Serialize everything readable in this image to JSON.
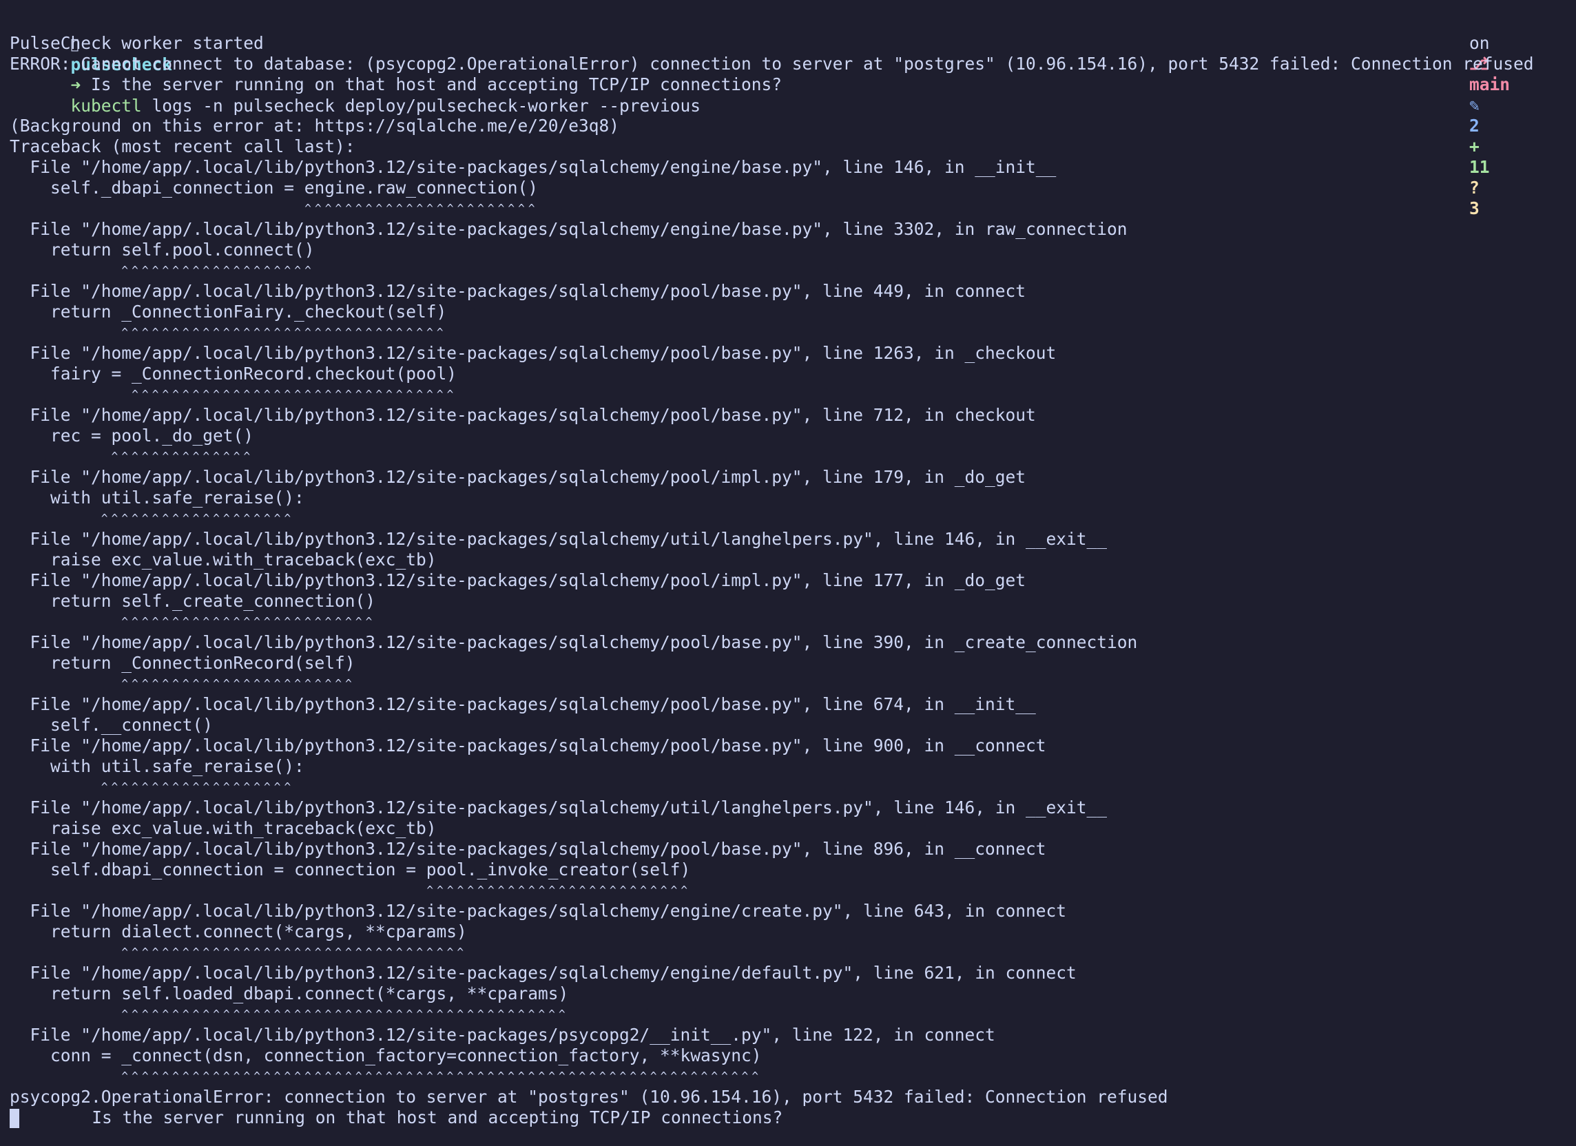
{
  "prompt": {
    "apple_icon": "",
    "directory": "pulsecheck",
    "arrow": "➜",
    "command": "kubectl",
    "args": " logs -n pulsecheck deploy/pulsecheck-worker --previous",
    "on_label": "on",
    "branch_icon": "⎇",
    "branch": "main",
    "modified_icon": "✎",
    "modified_count": "2",
    "added_icon": "+",
    "added_count": "11",
    "untracked_icon": "?",
    "untracked_count": "3"
  },
  "lines": [
    "PulseCheck worker started",
    "ERROR: Cannot connect to database: (psycopg2.OperationalError) connection to server at \"postgres\" (10.96.154.16), port 5432 failed: Connection refused",
    "        Is the server running on that host and accepting TCP/IP connections?",
    "",
    "(Background on this error at: https://sqlalche.me/e/20/e3q8)",
    "Traceback (most recent call last):",
    "  File \"/home/app/.local/lib/python3.12/site-packages/sqlalchemy/engine/base.py\", line 146, in __init__",
    "    self._dbapi_connection = engine.raw_connection()",
    "                             ^^^^^^^^^^^^^^^^^^^^^^^",
    "  File \"/home/app/.local/lib/python3.12/site-packages/sqlalchemy/engine/base.py\", line 3302, in raw_connection",
    "    return self.pool.connect()",
    "           ^^^^^^^^^^^^^^^^^^^",
    "  File \"/home/app/.local/lib/python3.12/site-packages/sqlalchemy/pool/base.py\", line 449, in connect",
    "    return _ConnectionFairy._checkout(self)",
    "           ^^^^^^^^^^^^^^^^^^^^^^^^^^^^^^^^",
    "  File \"/home/app/.local/lib/python3.12/site-packages/sqlalchemy/pool/base.py\", line 1263, in _checkout",
    "    fairy = _ConnectionRecord.checkout(pool)",
    "            ^^^^^^^^^^^^^^^^^^^^^^^^^^^^^^^^",
    "  File \"/home/app/.local/lib/python3.12/site-packages/sqlalchemy/pool/base.py\", line 712, in checkout",
    "    rec = pool._do_get()",
    "          ^^^^^^^^^^^^^^",
    "  File \"/home/app/.local/lib/python3.12/site-packages/sqlalchemy/pool/impl.py\", line 179, in _do_get",
    "    with util.safe_reraise():",
    "         ^^^^^^^^^^^^^^^^^^^",
    "  File \"/home/app/.local/lib/python3.12/site-packages/sqlalchemy/util/langhelpers.py\", line 146, in __exit__",
    "    raise exc_value.with_traceback(exc_tb)",
    "  File \"/home/app/.local/lib/python3.12/site-packages/sqlalchemy/pool/impl.py\", line 177, in _do_get",
    "    return self._create_connection()",
    "           ^^^^^^^^^^^^^^^^^^^^^^^^^",
    "  File \"/home/app/.local/lib/python3.12/site-packages/sqlalchemy/pool/base.py\", line 390, in _create_connection",
    "    return _ConnectionRecord(self)",
    "           ^^^^^^^^^^^^^^^^^^^^^^^",
    "  File \"/home/app/.local/lib/python3.12/site-packages/sqlalchemy/pool/base.py\", line 674, in __init__",
    "    self.__connect()",
    "  File \"/home/app/.local/lib/python3.12/site-packages/sqlalchemy/pool/base.py\", line 900, in __connect",
    "    with util.safe_reraise():",
    "         ^^^^^^^^^^^^^^^^^^^",
    "  File \"/home/app/.local/lib/python3.12/site-packages/sqlalchemy/util/langhelpers.py\", line 146, in __exit__",
    "    raise exc_value.with_traceback(exc_tb)",
    "  File \"/home/app/.local/lib/python3.12/site-packages/sqlalchemy/pool/base.py\", line 896, in __connect",
    "    self.dbapi_connection = connection = pool._invoke_creator(self)",
    "                                         ^^^^^^^^^^^^^^^^^^^^^^^^^^",
    "  File \"/home/app/.local/lib/python3.12/site-packages/sqlalchemy/engine/create.py\", line 643, in connect",
    "    return dialect.connect(*cargs, **cparams)",
    "           ^^^^^^^^^^^^^^^^^^^^^^^^^^^^^^^^^^",
    "  File \"/home/app/.local/lib/python3.12/site-packages/sqlalchemy/engine/default.py\", line 621, in connect",
    "    return self.loaded_dbapi.connect(*cargs, **cparams)",
    "           ^^^^^^^^^^^^^^^^^^^^^^^^^^^^^^^^^^^^^^^^^^^^",
    "  File \"/home/app/.local/lib/python3.12/site-packages/psycopg2/__init__.py\", line 122, in connect",
    "    conn = _connect(dsn, connection_factory=connection_factory, **kwasync)",
    "           ^^^^^^^^^^^^^^^^^^^^^^^^^^^^^^^^^^^^^^^^^^^^^^^^^^^^^^^^^^^^^^^",
    "psycopg2.OperationalError: connection to server at \"postgres\" (10.96.154.16), port 5432 failed: Connection refused"
  ],
  "last_line": "       Is the server running on that host and accepting TCP/IP connections?"
}
